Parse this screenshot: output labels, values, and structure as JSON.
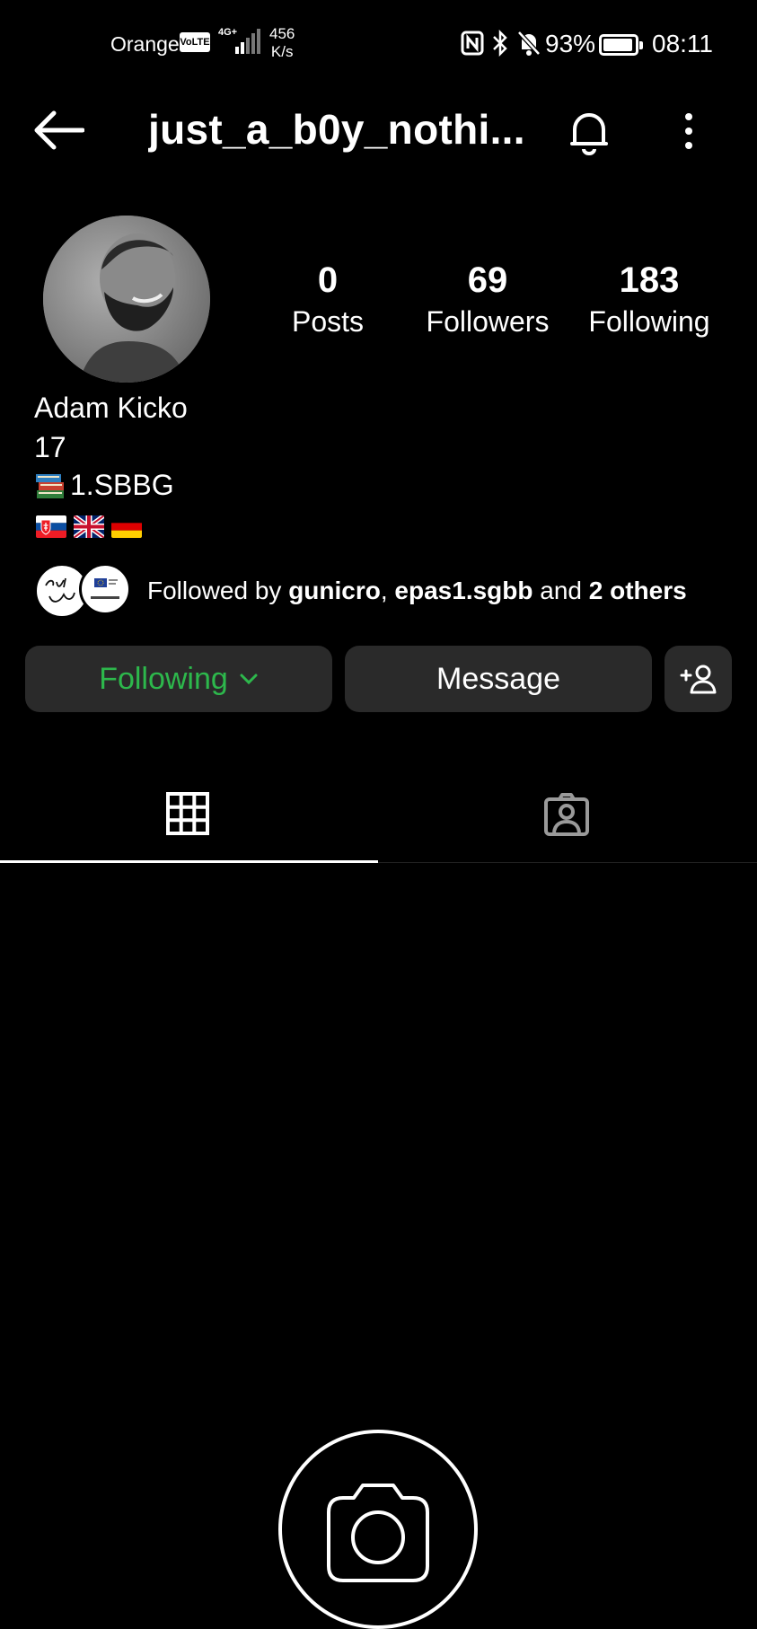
{
  "status_bar": {
    "carrier": "Orange",
    "volte": "VoLTE",
    "network": "4G+",
    "speed_value": "456",
    "speed_unit": "K/s",
    "battery": "93%",
    "battery_level": 0.93,
    "time": "08:11"
  },
  "header": {
    "username": "just_a_b0y_nothi..."
  },
  "stats": {
    "posts": {
      "value": "0",
      "label": "Posts"
    },
    "followers": {
      "value": "69",
      "label": "Followers"
    },
    "following": {
      "value": "183",
      "label": "Following"
    }
  },
  "bio": {
    "name": "Adam Kicko",
    "age": "17",
    "school": "1.SBBG",
    "flags": [
      "slovakia-flag",
      "uk-flag",
      "germany-flag"
    ]
  },
  "followed_by": {
    "prefix": "Followed by ",
    "user1": "gunicro",
    "sep": ", ",
    "user2": "epas1.sgbb",
    "and": " and ",
    "others": "2 others"
  },
  "buttons": {
    "following": "Following",
    "message": "Message"
  },
  "colors": {
    "following_green": "#2db84c",
    "button_bg": "#2a2a2a",
    "background": "#000000"
  }
}
